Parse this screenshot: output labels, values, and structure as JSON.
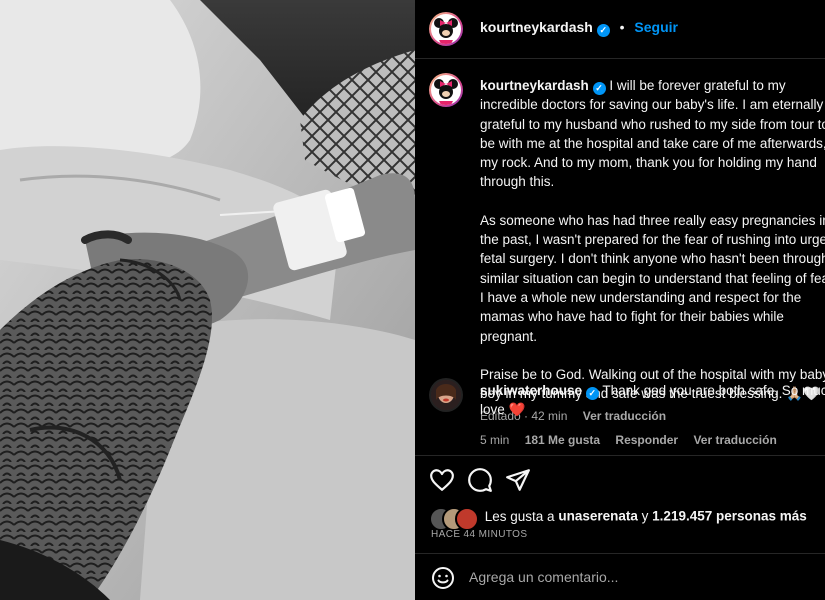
{
  "header": {
    "username": "kourtneykardash",
    "dot": "•",
    "follow_label": "Seguir"
  },
  "caption": {
    "username": "kourtneykardash",
    "paragraph1": "I will be forever grateful to my incredible doctors for saving our baby's life. I am eternally grateful to my husband who rushed to my side from tour to be with me at the hospital and take care of me afterwards, my rock. And to my mom, thank you for holding my hand through this.",
    "paragraph2": "As someone who has had three really easy pregnancies in the past, I wasn't prepared for the fear of rushing into urgent fetal surgery. I don't think anyone who hasn't been through a similar situation can begin to understand that feeling of fear. I have a whole new understanding and respect for the mamas who have had to fight for their babies while pregnant.",
    "paragraph3": "Praise be to God. Walking out of the hospital with my baby boy in my tummy and safe was the truest blessing. 🙏🏼🤍",
    "edited": "Editado · 42 min",
    "see_translation": "Ver traducción"
  },
  "comment": {
    "username": "sukiwaterhouse",
    "text": "Thank god you are both safe. So much love ❤️",
    "time": "5 min",
    "likes": "181 Me gusta",
    "reply": "Responder",
    "see_translation": "Ver traducción"
  },
  "likes": {
    "prefix": "Les gusta a",
    "first_user": "unaserenata",
    "connector": "y",
    "count": "1.219.457 personas más"
  },
  "time_ago": "HACE 44 MINUTOS",
  "comment_input": {
    "placeholder": "Agrega un comentario..."
  },
  "icons": {
    "like": "heart-icon",
    "comment": "comment-bubble-icon",
    "share": "paper-plane-icon",
    "emoji": "emoji-smile-icon",
    "verified": "verified-badge-icon"
  },
  "colors": {
    "accent": "#0095f6",
    "background": "#000000",
    "muted": "#a8a8a8",
    "heart": "#ed4956"
  }
}
